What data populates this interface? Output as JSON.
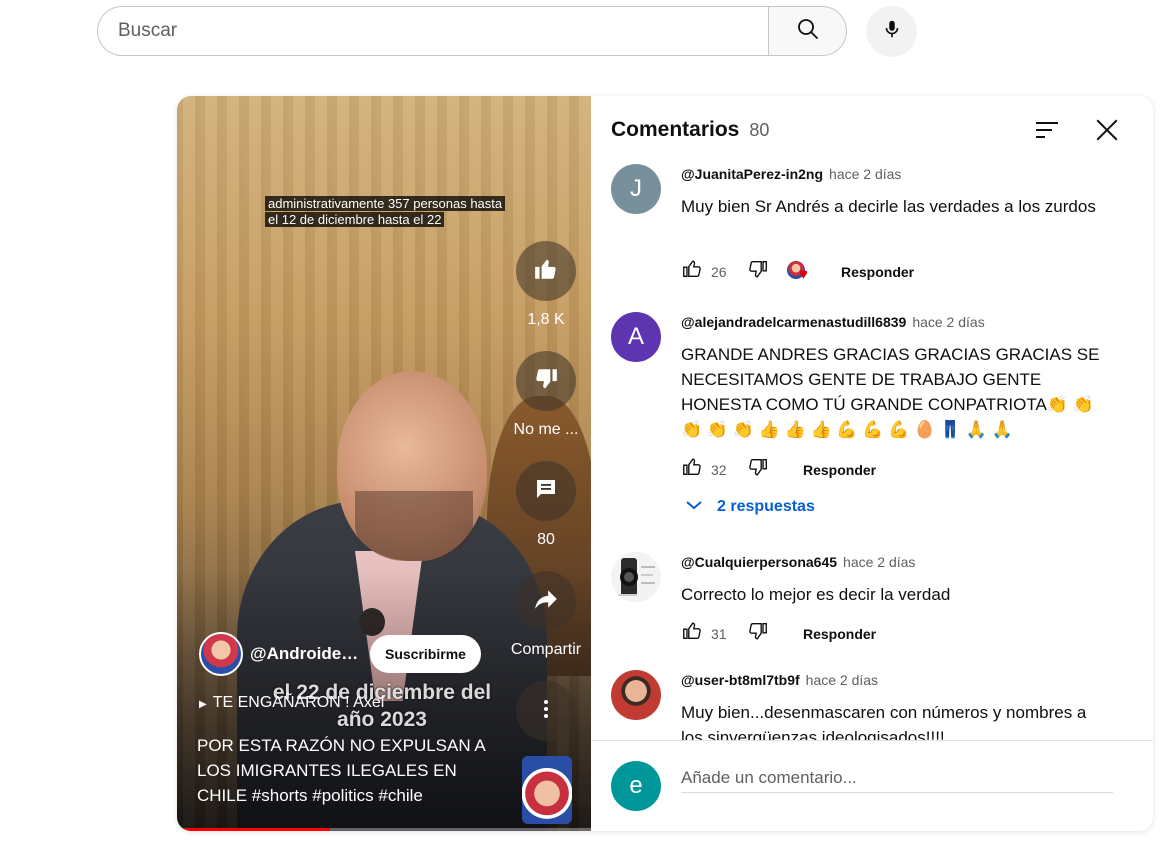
{
  "search": {
    "placeholder": "Buscar"
  },
  "video": {
    "caption_line1": "administrativamente 357 personas hasta",
    "caption_line2": "el 12 de diciembre hasta el 22",
    "like_count": "1,8 K",
    "dislike_label": "No me ...",
    "comments_count": "80",
    "share_label": "Compartir",
    "channel_name": "@AndroideOcta",
    "subscribe_label": "Suscribirme",
    "overlay_text": "el 22 de diciembre del año 2023",
    "link_text": "TE ENGAÑARON ! Axel",
    "title": "POR ESTA RAZÓN NO EXPULSAN A LOS IMIGRANTES ILEGALES EN CHILE #shorts #politics #chile",
    "progress": 0.37
  },
  "comments_panel": {
    "title": "Comentarios",
    "count": "80",
    "add_placeholder": "Añade un comentario...",
    "user_initial": "e",
    "comments": [
      {
        "author": "@JuanitaPerez-in2ng",
        "time": "hace 2 días",
        "text": "Muy bien Sr Andrés a decirle las verdades a los zurdos",
        "likes": "26",
        "reply": "Responder",
        "avatar_initial": "J",
        "avatar_color": "#78909c"
      },
      {
        "author": "@alejandradelcarmenastudill6839",
        "time": "hace 2 días",
        "text": "GRANDE ANDRES GRACIAS GRACIAS GRACIAS SE NECESITAMOS GENTE DE TRABAJO GENTE HONESTA COMO TÚ GRANDE CONPATRIOTA👏 👏 👏 👏 👏 👍 👍 👍 💪 💪 💪 🥚 👖 🙏 🙏",
        "likes": "32",
        "reply": "Responder",
        "avatar_initial": "A",
        "avatar_color": "#5e35b1",
        "replies_label": "2 respuestas"
      },
      {
        "author": "@Cualquierpersona645",
        "time": "hace 2 días",
        "text": "Correcto lo mejor es decir la verdad",
        "likes": "31",
        "reply": "Responder"
      },
      {
        "author": "@user-bt8ml7tb9f",
        "time": "hace 2 días",
        "text": "Muy bien...desenmascaren con números y nombres a los sinvergüenzas ideologisados!!!!"
      }
    ]
  }
}
